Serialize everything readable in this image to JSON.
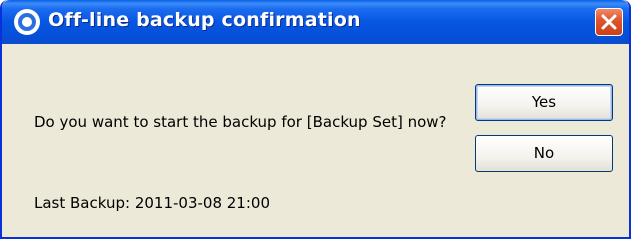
{
  "window": {
    "title": "Off-line backup confirmation",
    "title_icon": "circle-target-icon",
    "close_icon": "close-icon"
  },
  "dialog": {
    "message": "Do you want to start the backup for [Backup Set] now?",
    "last_backup": "Last Backup: 2011-03-08 21:00"
  },
  "buttons": {
    "yes_label": "Yes",
    "no_label": "No"
  },
  "colors": {
    "titlebar": "#0756e3",
    "close_button": "#e0572e",
    "dialog_background": "#ece9d8"
  }
}
